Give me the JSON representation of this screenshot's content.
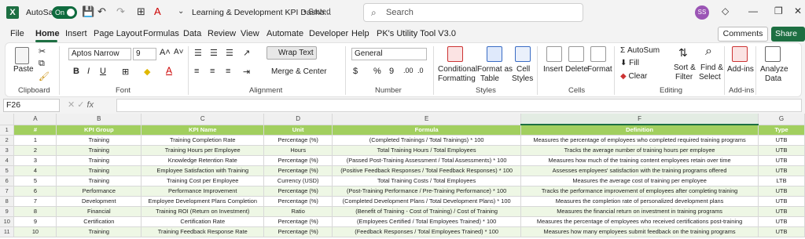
{
  "titlebar": {
    "autosave_label": "AutoSave",
    "autosave_state": "On",
    "doc_title": "Learning & Development KPI Dashb...",
    "saved_label": "• Saved",
    "search_placeholder": "Search",
    "avatar_initials": "SS"
  },
  "menu": {
    "items": [
      "File",
      "Home",
      "Insert",
      "Page Layout",
      "Formulas",
      "Data",
      "Review",
      "View",
      "Automate",
      "Developer",
      "Help",
      "PK's Utility Tool V3.0"
    ],
    "comments": "Comments",
    "share": "Share"
  },
  "ribbon": {
    "clipboard": {
      "paste": "Paste",
      "label": "Clipboard"
    },
    "font": {
      "name": "Aptos Narrow",
      "size": "9",
      "label": "Font"
    },
    "alignment": {
      "wrap": "Wrap Text",
      "merge": "Merge & Center",
      "label": "Alignment"
    },
    "number": {
      "format": "General",
      "label": "Number"
    },
    "styles": {
      "cond": "Conditional",
      "cond2": "Formatting",
      "fmt": "Format as",
      "fmt2": "Table",
      "cell": "Cell",
      "cell2": "Styles",
      "label": "Styles"
    },
    "cells": {
      "insert": "Insert",
      "delete": "Delete",
      "format": "Format",
      "label": "Cells"
    },
    "editing": {
      "autosum": "AutoSum",
      "fill": "Fill",
      "clear": "Clear",
      "sort": "Sort &",
      "sort2": "Filter",
      "find": "Find &",
      "find2": "Select",
      "label": "Editing"
    },
    "addins": {
      "addins": "Add-ins",
      "label": "Add-ins"
    },
    "analyze": {
      "a1": "Analyze",
      "a2": "Data"
    }
  },
  "formula_bar": {
    "cell_ref": "F26",
    "fx": "fx",
    "value": ""
  },
  "sheet": {
    "columns": [
      "A",
      "B",
      "C",
      "D",
      "E",
      "F",
      "G"
    ],
    "header": [
      "#",
      "KPI Group",
      "KPI Name",
      "Unit",
      "Formula",
      "Definition",
      "Type"
    ],
    "rows": [
      [
        "1",
        "Training",
        "Training Completion Rate",
        "Percentage (%)",
        "(Completed Trainings / Total Trainings) * 100",
        "Measures the percentage of employees who completed required training programs",
        "UTB"
      ],
      [
        "2",
        "Training",
        "Training Hours per Employee",
        "Hours",
        "Total Training Hours / Total Employees",
        "Tracks the average number of training hours per employee",
        "UTB"
      ],
      [
        "3",
        "Training",
        "Knowledge Retention Rate",
        "Percentage (%)",
        "(Passed Post-Training Assessment / Total Assessments) * 100",
        "Measures how much of the training content employees retain over time",
        "UTB"
      ],
      [
        "4",
        "Training",
        "Employee Satisfaction with Training",
        "Percentage (%)",
        "(Positive Feedback Responses / Total Feedback Responses) * 100",
        "Assesses employees' satisfaction with the training programs offered",
        "UTB"
      ],
      [
        "5",
        "Training",
        "Training Cost per Employee",
        "Currency (USD)",
        "Total Training Costs / Total Employees",
        "Measures the average cost of training per employee",
        "LTB"
      ],
      [
        "6",
        "Performance",
        "Performance Improvement",
        "Percentage (%)",
        "(Post-Training Performance / Pre-Training Performance) * 100",
        "Tracks the performance improvement of employees after completing training",
        "UTB"
      ],
      [
        "7",
        "Development",
        "Employee Development Plans Completion",
        "Percentage (%)",
        "(Completed Development Plans / Total Development Plans) * 100",
        "Measures the completion rate of personalized development plans",
        "UTB"
      ],
      [
        "8",
        "Financial",
        "Training ROI (Return on Investment)",
        "Ratio",
        "(Benefit of Training - Cost of Training) / Cost of Training",
        "Measures the financial return on investment in training programs",
        "UTB"
      ],
      [
        "9",
        "Certification",
        "Certification Rate",
        "Percentage (%)",
        "(Employees Certified / Total Employees Trained) * 100",
        "Measures the percentage of employees who received certifications post-training",
        "UTB"
      ],
      [
        "10",
        "Training",
        "Training Feedback Response Rate",
        "Percentage (%)",
        "(Feedback Responses / Total Employees Trained) * 100",
        "Measures how many employees submit feedback on the training programs",
        "UTB"
      ]
    ]
  }
}
